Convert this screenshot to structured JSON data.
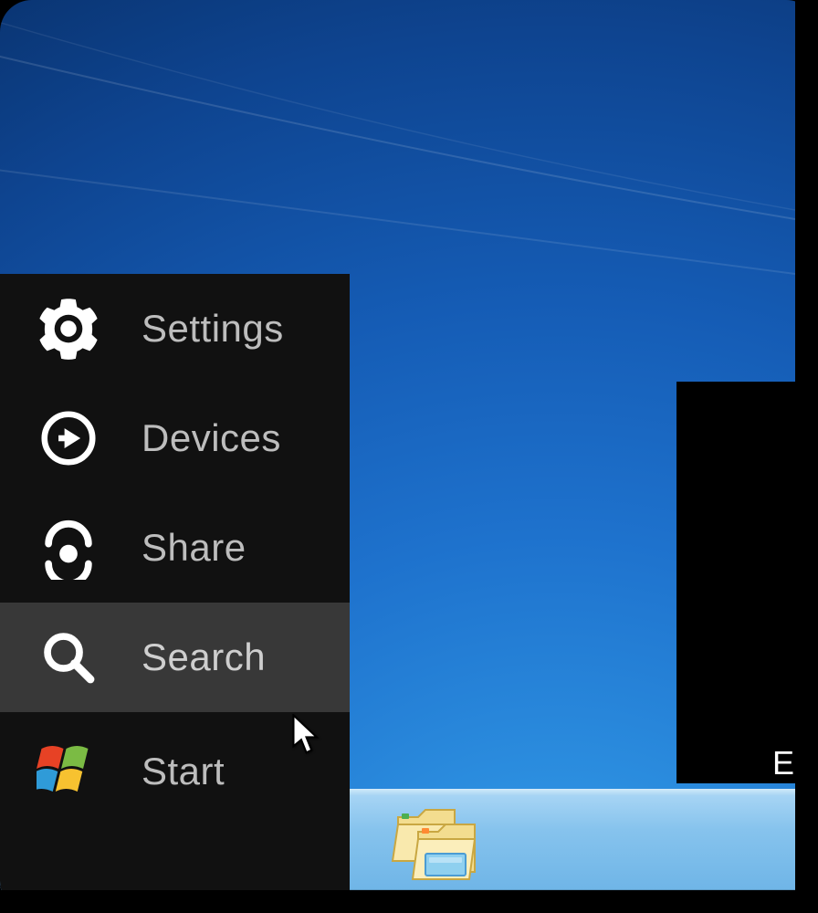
{
  "charms": {
    "settings": {
      "label": "Settings",
      "icon": "gear-icon"
    },
    "devices": {
      "label": "Devices",
      "icon": "devices-icon"
    },
    "share": {
      "label": "Share",
      "icon": "share-icon"
    },
    "search": {
      "label": "Search",
      "icon": "search-icon",
      "hovered": true
    },
    "start": {
      "label": "Start",
      "icon": "windows-logo-icon"
    }
  },
  "taskbar": {
    "file_explorer": "File Explorer"
  },
  "truncated_right_text": "E"
}
